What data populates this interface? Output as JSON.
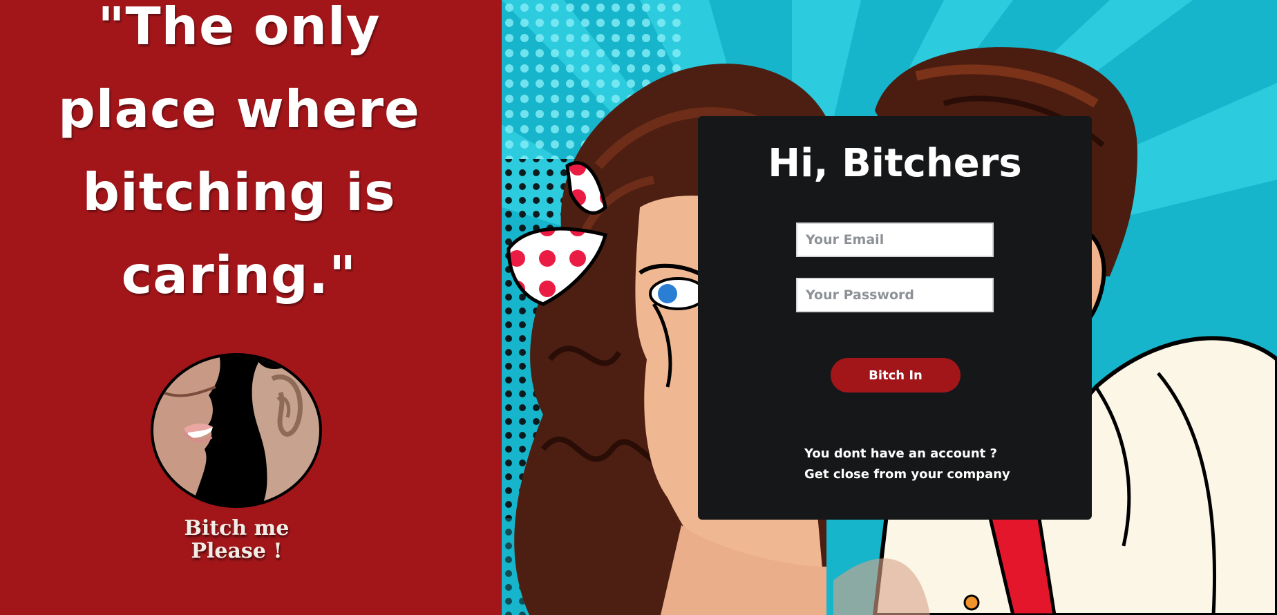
{
  "left": {
    "quote_lines": [
      "\"The only",
      "place where",
      "bitching is",
      "caring.\""
    ],
    "brand_line1": "Bitch me",
    "brand_line2": "Please !",
    "logo_icon": "whisper-ear-lips-icon"
  },
  "login": {
    "title": "Hi, Bitchers",
    "email_placeholder": "Your Email",
    "password_placeholder": "Your Password",
    "submit_label": "Bitch In",
    "note_line1": "You dont have an account ?",
    "note_line2": "Get close from your company"
  },
  "colors": {
    "brand_red": "#a2161a",
    "card_bg": "#161718",
    "pop_cyan": "#1fb7cc"
  }
}
